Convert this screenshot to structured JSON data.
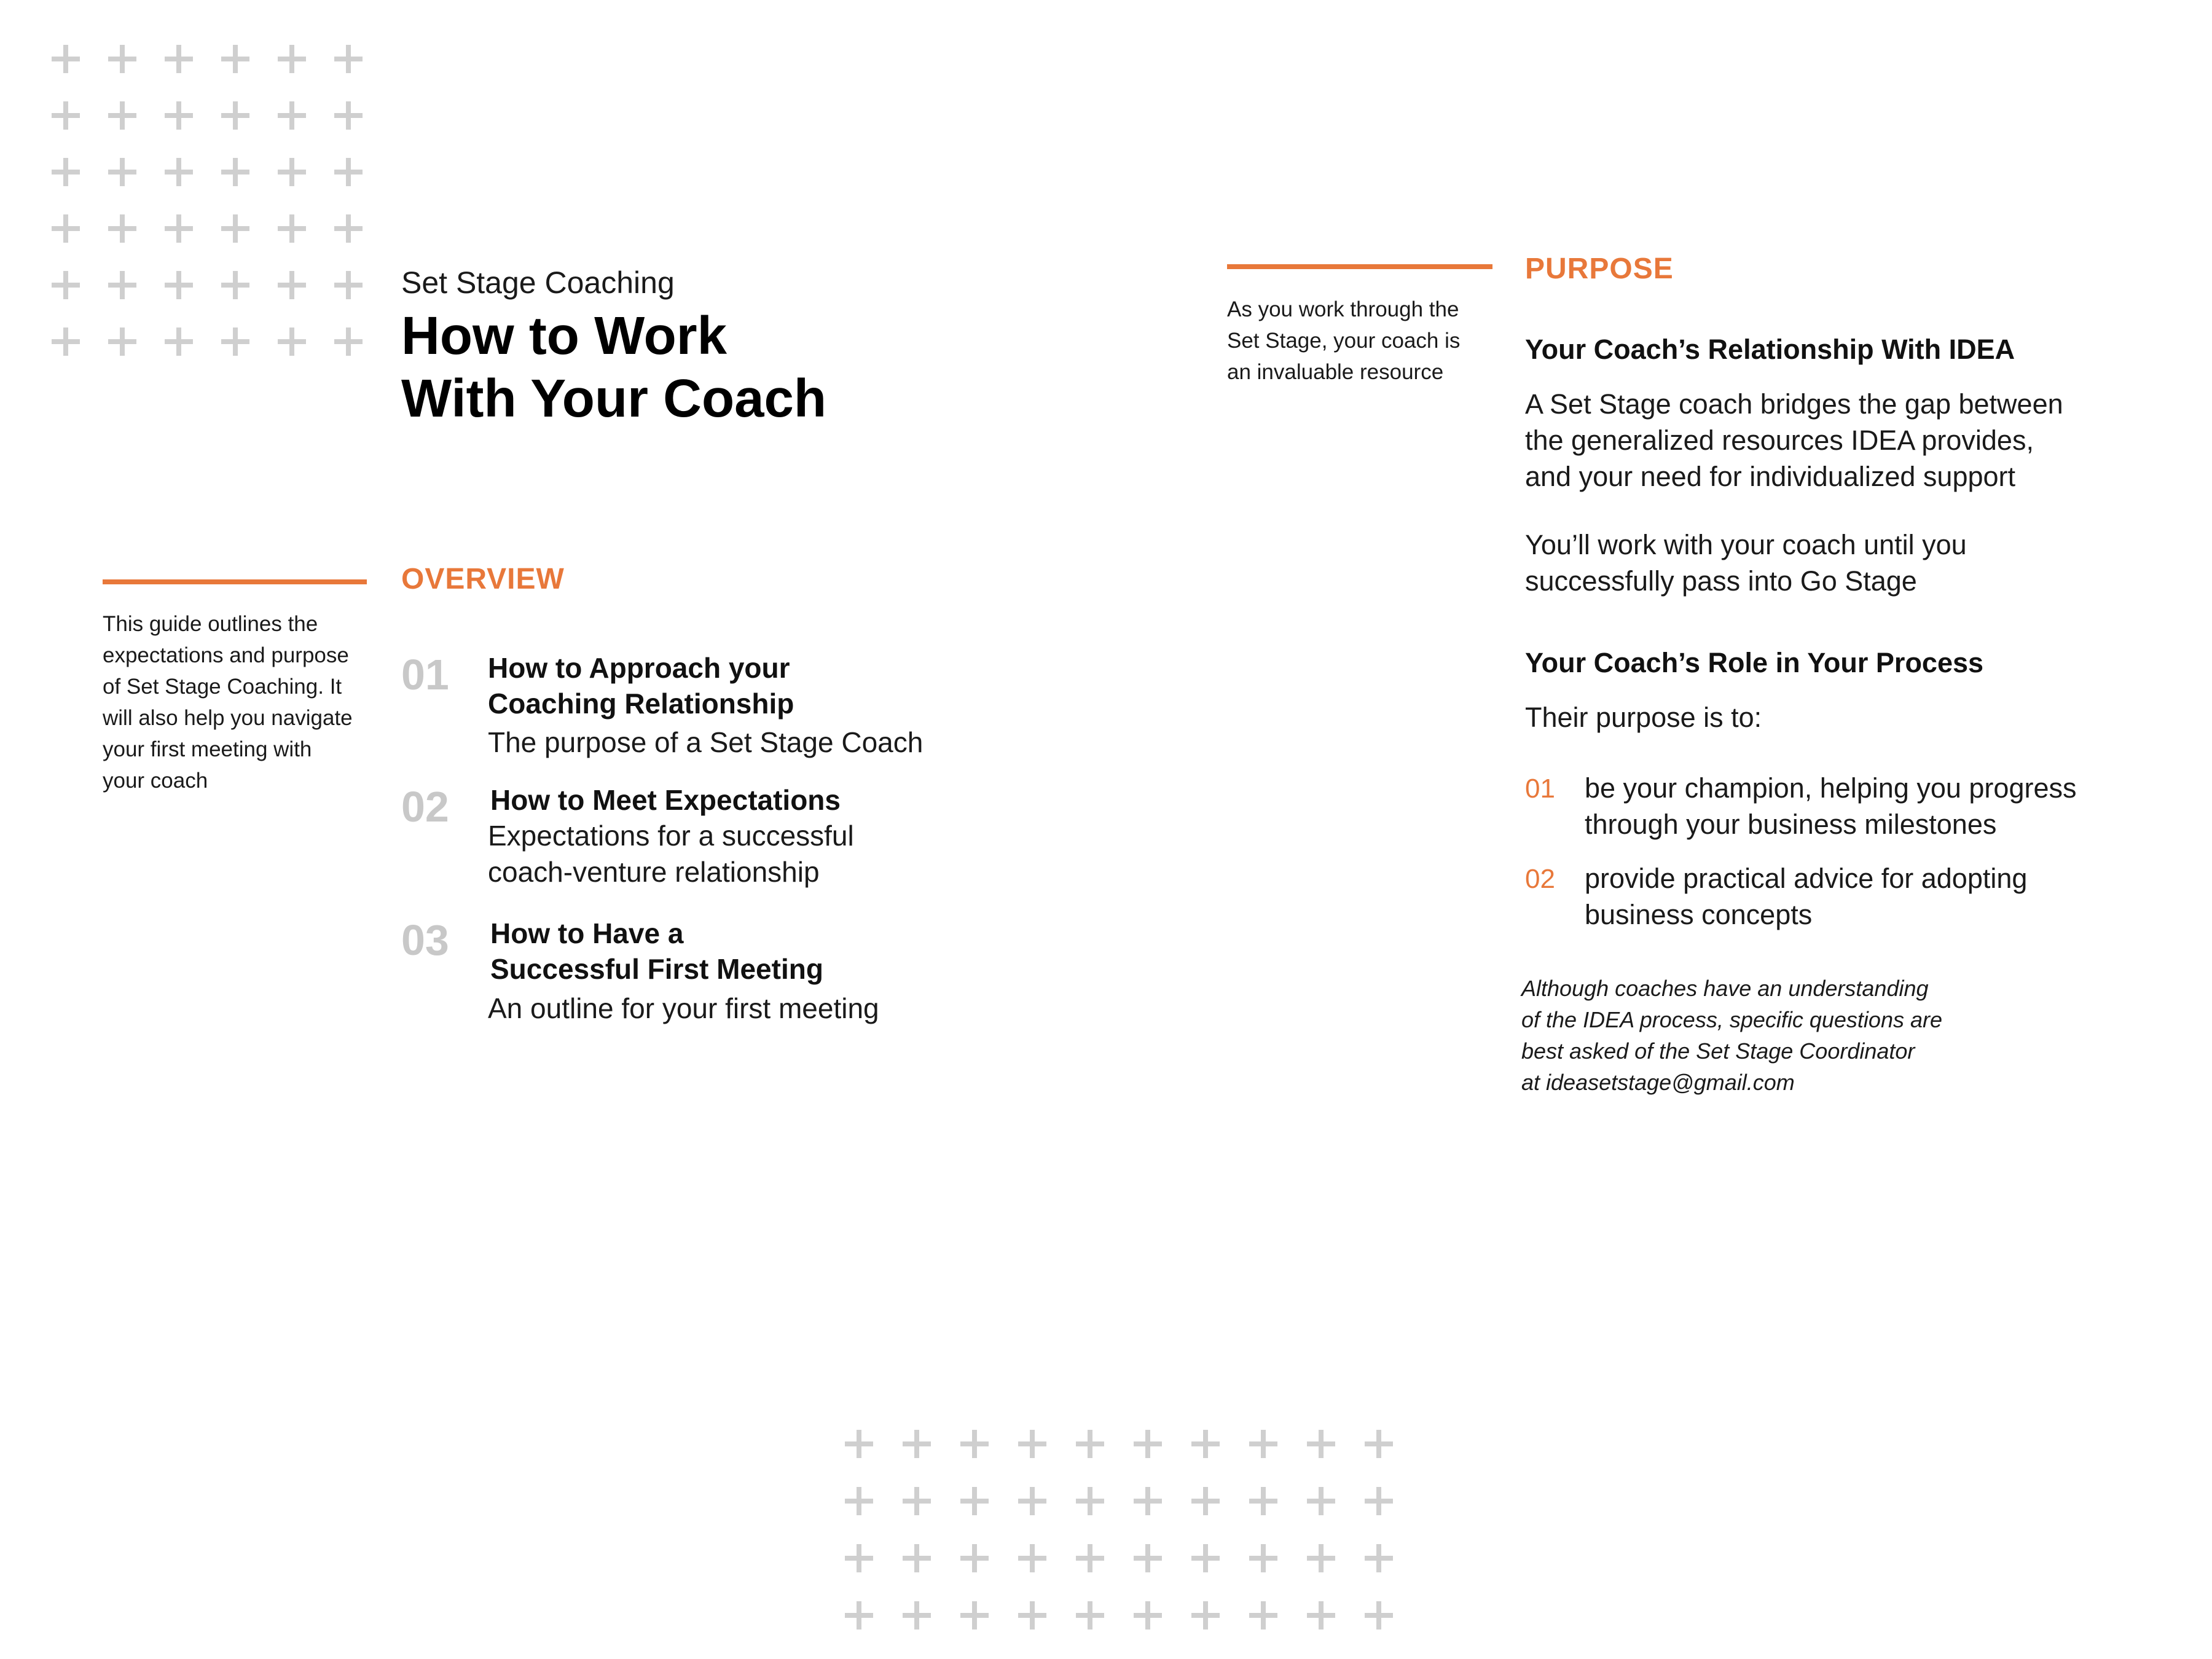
{
  "colors": {
    "accent": "#E8783A",
    "plus": "#CFCFCF",
    "number_gray": "#C8C8C8"
  },
  "decor": {
    "top_left_plus_grid": {
      "rows": 6,
      "cols": 6
    },
    "bottom_plus_grid": {
      "rows": 4,
      "cols": 10
    }
  },
  "header": {
    "kicker": "Set Stage Coaching",
    "title_line1": "How to Work",
    "title_line2": "With Your Coach"
  },
  "intro_note": {
    "lines": [
      "This guide outlines the",
      "expectations and purpose",
      "of Set Stage Coaching. It",
      "will also help you navigate",
      "your first meeting with",
      "your coach"
    ]
  },
  "overview": {
    "heading": "OVERVIEW",
    "items": [
      {
        "num": "01",
        "title_lines": [
          "How to Approach your",
          "Coaching Relationship"
        ],
        "desc_lines": [
          "The purpose of a Set Stage Coach"
        ]
      },
      {
        "num": "02",
        "title_lines": [
          "How to Meet Expectations"
        ],
        "desc_lines": [
          "Expectations for a successful",
          "coach-venture relationship"
        ]
      },
      {
        "num": "03",
        "title_lines": [
          "How to Have a",
          "Successful First Meeting"
        ],
        "desc_lines": [
          "An outline for your first meeting"
        ]
      }
    ]
  },
  "purpose_note": {
    "lines": [
      "As you work through the",
      "Set Stage, your coach is",
      "an invaluable resource"
    ]
  },
  "purpose": {
    "heading": "PURPOSE",
    "sub1": "Your Coach’s Relationship With IDEA",
    "para1_lines": [
      "A Set Stage coach bridges the gap between",
      "the generalized resources IDEA provides,",
      "and your need for individualized support"
    ],
    "para2_lines": [
      "You’ll work with your coach until you",
      "successfully pass into Go Stage"
    ],
    "sub2": "Your Coach’s Role in Your Process",
    "lead": "Their purpose is to:",
    "items": [
      {
        "num": "01",
        "lines": [
          "be your champion, helping you progress",
          "through your business milestones"
        ]
      },
      {
        "num": "02",
        "lines": [
          "provide practical advice for adopting",
          "business concepts"
        ]
      }
    ],
    "note_lines": [
      "Although coaches have an understanding",
      "of the IDEA process, specific questions are",
      "best asked of the Set Stage Coordinator",
      "at ideasetstage@gmail.com"
    ]
  }
}
